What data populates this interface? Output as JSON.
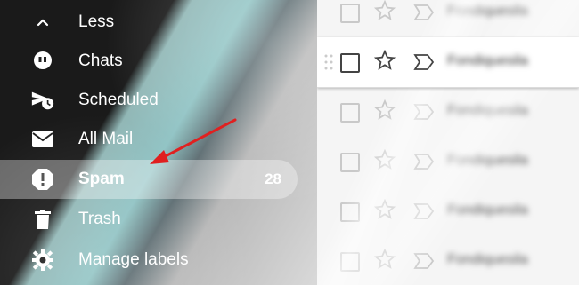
{
  "sidebar": {
    "items": [
      {
        "label": "Less",
        "icon": "chevron-up-icon"
      },
      {
        "label": "Chats",
        "icon": "chat-bubble-icon"
      },
      {
        "label": "Scheduled",
        "icon": "scheduled-send-icon"
      },
      {
        "label": "All Mail",
        "icon": "envelope-icon"
      },
      {
        "label": "Spam",
        "icon": "spam-warning-icon",
        "count": "28",
        "active": true
      },
      {
        "label": "Trash",
        "icon": "trash-icon"
      },
      {
        "label": "Manage labels",
        "icon": "gear-icon"
      }
    ]
  },
  "list": {
    "rows": [
      {
        "sender": "Fondiquesila"
      },
      {
        "sender": "Fondiquesila"
      },
      {
        "sender": "Fondiquesila"
      },
      {
        "sender": "Fondiquesila"
      },
      {
        "sender": "Fondiquesila"
      },
      {
        "sender": "Fondiquesila"
      }
    ]
  },
  "colors": {
    "accent_arrow": "#e02020",
    "active_bg": "rgba(255,255,255,0.35)"
  }
}
